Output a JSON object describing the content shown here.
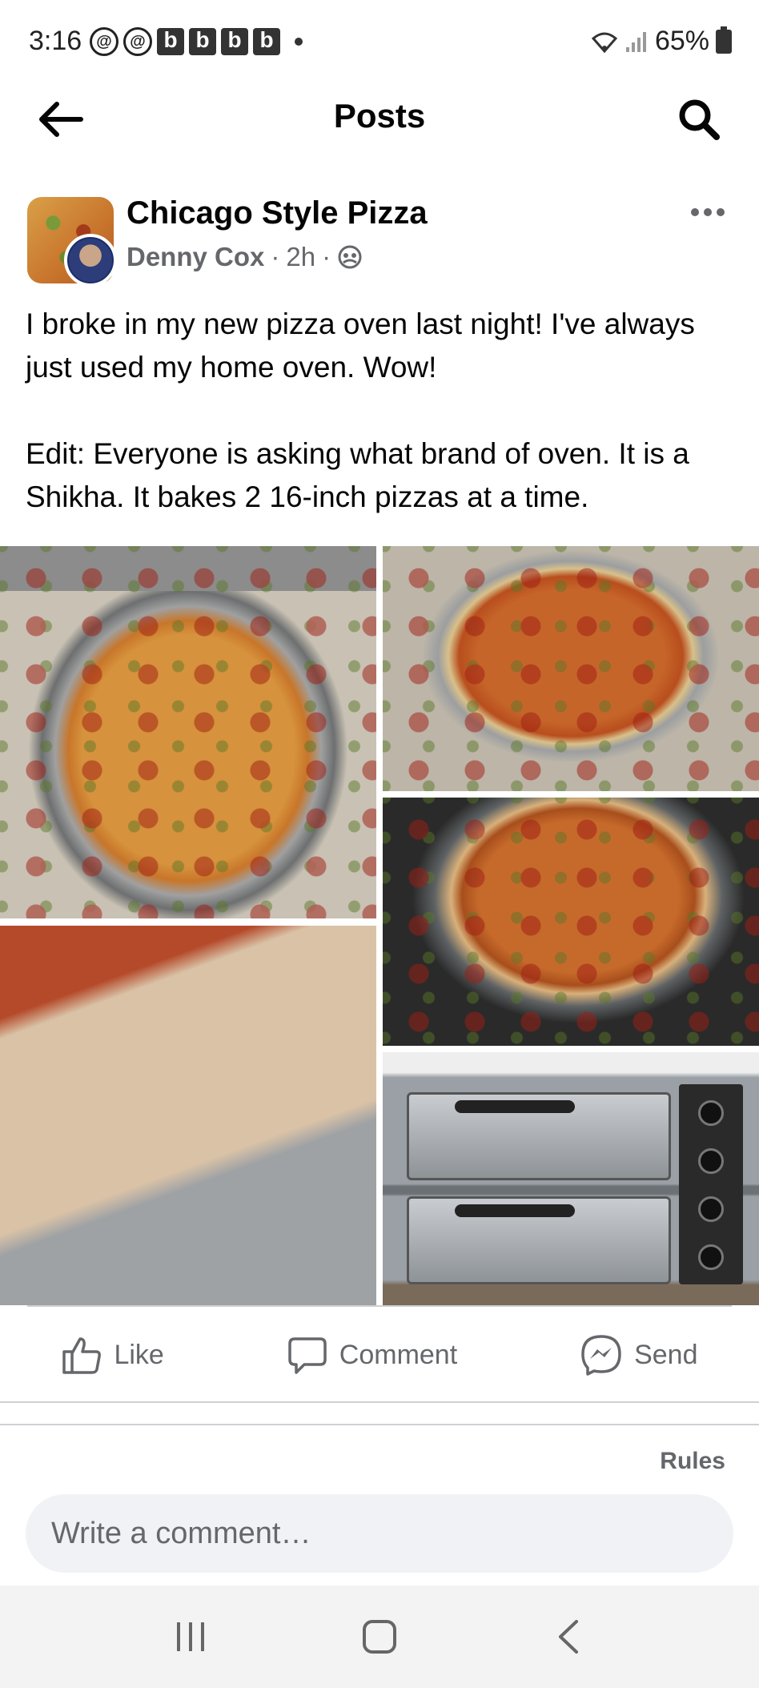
{
  "status_bar": {
    "time": "3:16",
    "app_icons": [
      "threads-icon",
      "threads-icon",
      "b",
      "b",
      "b",
      "b"
    ],
    "notification_letter": "b",
    "battery_percent": "65%"
  },
  "header": {
    "title": "Posts",
    "back_icon": "arrow-left-icon",
    "search_icon": "search-icon"
  },
  "post": {
    "group_name": "Chicago Style Pizza",
    "author": "Denny Cox",
    "time_ago": "2h",
    "separator": "·",
    "audience_icon": "group-privacy-icon",
    "text_paragraphs": [
      "I broke in my new pizza oven last night! I've always just used my home oven. Wow!",
      "Edit: Everyone is asking what brand of oven. It is a Shikha. It bakes 2 16-inch pizzas at a time."
    ],
    "photo_count": 5
  },
  "actions": {
    "like_label": "Like",
    "comment_label": "Comment",
    "send_label": "Send"
  },
  "comments": {
    "rules_label": "Rules",
    "input_placeholder": "Write a comment…"
  },
  "colors": {
    "primary_text": "#050505",
    "secondary_text": "#65676b",
    "input_bg": "#f0f2f5",
    "divider": "#ced0d4"
  }
}
